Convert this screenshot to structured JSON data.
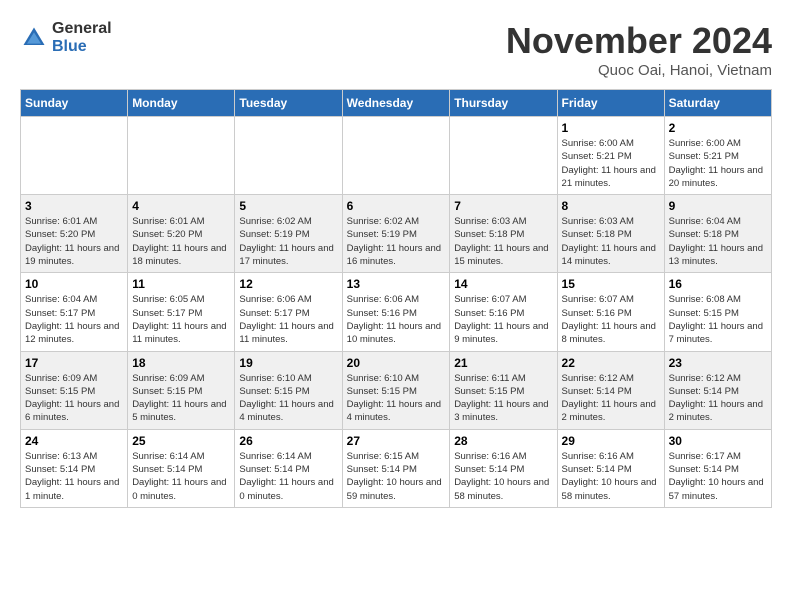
{
  "logo": {
    "general": "General",
    "blue": "Blue"
  },
  "title": "November 2024",
  "subtitle": "Quoc Oai, Hanoi, Vietnam",
  "days_of_week": [
    "Sunday",
    "Monday",
    "Tuesday",
    "Wednesday",
    "Thursday",
    "Friday",
    "Saturday"
  ],
  "weeks": [
    [
      {
        "day": "",
        "info": ""
      },
      {
        "day": "",
        "info": ""
      },
      {
        "day": "",
        "info": ""
      },
      {
        "day": "",
        "info": ""
      },
      {
        "day": "",
        "info": ""
      },
      {
        "day": "1",
        "info": "Sunrise: 6:00 AM\nSunset: 5:21 PM\nDaylight: 11 hours and 21 minutes."
      },
      {
        "day": "2",
        "info": "Sunrise: 6:00 AM\nSunset: 5:21 PM\nDaylight: 11 hours and 20 minutes."
      }
    ],
    [
      {
        "day": "3",
        "info": "Sunrise: 6:01 AM\nSunset: 5:20 PM\nDaylight: 11 hours and 19 minutes."
      },
      {
        "day": "4",
        "info": "Sunrise: 6:01 AM\nSunset: 5:20 PM\nDaylight: 11 hours and 18 minutes."
      },
      {
        "day": "5",
        "info": "Sunrise: 6:02 AM\nSunset: 5:19 PM\nDaylight: 11 hours and 17 minutes."
      },
      {
        "day": "6",
        "info": "Sunrise: 6:02 AM\nSunset: 5:19 PM\nDaylight: 11 hours and 16 minutes."
      },
      {
        "day": "7",
        "info": "Sunrise: 6:03 AM\nSunset: 5:18 PM\nDaylight: 11 hours and 15 minutes."
      },
      {
        "day": "8",
        "info": "Sunrise: 6:03 AM\nSunset: 5:18 PM\nDaylight: 11 hours and 14 minutes."
      },
      {
        "day": "9",
        "info": "Sunrise: 6:04 AM\nSunset: 5:18 PM\nDaylight: 11 hours and 13 minutes."
      }
    ],
    [
      {
        "day": "10",
        "info": "Sunrise: 6:04 AM\nSunset: 5:17 PM\nDaylight: 11 hours and 12 minutes."
      },
      {
        "day": "11",
        "info": "Sunrise: 6:05 AM\nSunset: 5:17 PM\nDaylight: 11 hours and 11 minutes."
      },
      {
        "day": "12",
        "info": "Sunrise: 6:06 AM\nSunset: 5:17 PM\nDaylight: 11 hours and 11 minutes."
      },
      {
        "day": "13",
        "info": "Sunrise: 6:06 AM\nSunset: 5:16 PM\nDaylight: 11 hours and 10 minutes."
      },
      {
        "day": "14",
        "info": "Sunrise: 6:07 AM\nSunset: 5:16 PM\nDaylight: 11 hours and 9 minutes."
      },
      {
        "day": "15",
        "info": "Sunrise: 6:07 AM\nSunset: 5:16 PM\nDaylight: 11 hours and 8 minutes."
      },
      {
        "day": "16",
        "info": "Sunrise: 6:08 AM\nSunset: 5:15 PM\nDaylight: 11 hours and 7 minutes."
      }
    ],
    [
      {
        "day": "17",
        "info": "Sunrise: 6:09 AM\nSunset: 5:15 PM\nDaylight: 11 hours and 6 minutes."
      },
      {
        "day": "18",
        "info": "Sunrise: 6:09 AM\nSunset: 5:15 PM\nDaylight: 11 hours and 5 minutes."
      },
      {
        "day": "19",
        "info": "Sunrise: 6:10 AM\nSunset: 5:15 PM\nDaylight: 11 hours and 4 minutes."
      },
      {
        "day": "20",
        "info": "Sunrise: 6:10 AM\nSunset: 5:15 PM\nDaylight: 11 hours and 4 minutes."
      },
      {
        "day": "21",
        "info": "Sunrise: 6:11 AM\nSunset: 5:15 PM\nDaylight: 11 hours and 3 minutes."
      },
      {
        "day": "22",
        "info": "Sunrise: 6:12 AM\nSunset: 5:14 PM\nDaylight: 11 hours and 2 minutes."
      },
      {
        "day": "23",
        "info": "Sunrise: 6:12 AM\nSunset: 5:14 PM\nDaylight: 11 hours and 2 minutes."
      }
    ],
    [
      {
        "day": "24",
        "info": "Sunrise: 6:13 AM\nSunset: 5:14 PM\nDaylight: 11 hours and 1 minute."
      },
      {
        "day": "25",
        "info": "Sunrise: 6:14 AM\nSunset: 5:14 PM\nDaylight: 11 hours and 0 minutes."
      },
      {
        "day": "26",
        "info": "Sunrise: 6:14 AM\nSunset: 5:14 PM\nDaylight: 11 hours and 0 minutes."
      },
      {
        "day": "27",
        "info": "Sunrise: 6:15 AM\nSunset: 5:14 PM\nDaylight: 10 hours and 59 minutes."
      },
      {
        "day": "28",
        "info": "Sunrise: 6:16 AM\nSunset: 5:14 PM\nDaylight: 10 hours and 58 minutes."
      },
      {
        "day": "29",
        "info": "Sunrise: 6:16 AM\nSunset: 5:14 PM\nDaylight: 10 hours and 58 minutes."
      },
      {
        "day": "30",
        "info": "Sunrise: 6:17 AM\nSunset: 5:14 PM\nDaylight: 10 hours and 57 minutes."
      }
    ]
  ]
}
